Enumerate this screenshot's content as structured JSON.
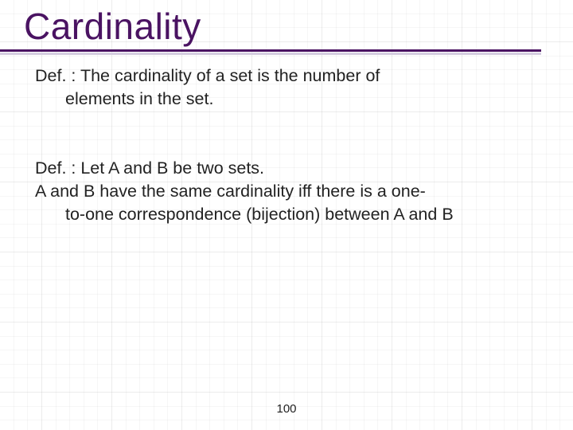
{
  "title": "Cardinality",
  "def1": {
    "line1": "Def. : The cardinality of a set is the number of",
    "line2": "elements in the set."
  },
  "def2": {
    "line1": "Def. : Let A and B be two sets.",
    "line2": " A and B have the same cardinality iff there is a one-",
    "line3": "to-one correspondence (bijection) between A and B"
  },
  "pageNumber": "100"
}
